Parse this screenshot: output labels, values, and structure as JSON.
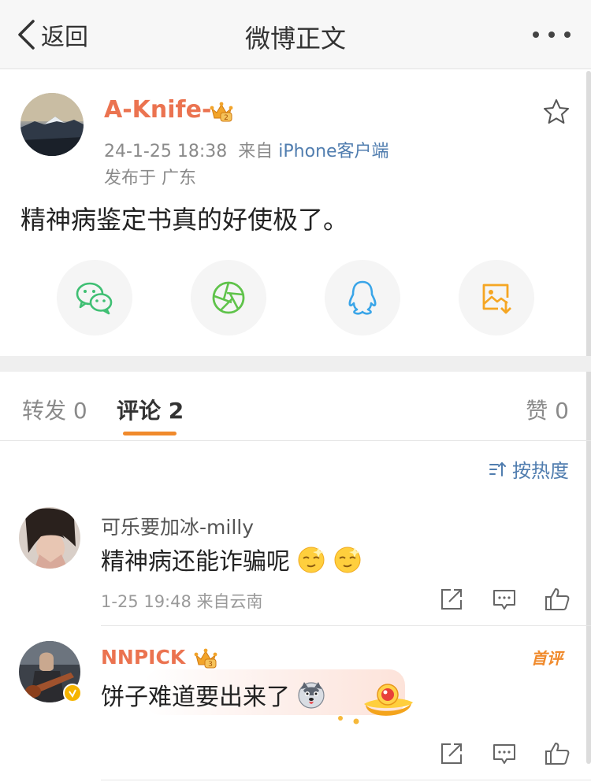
{
  "nav": {
    "back_label": "返回",
    "title": "微博正文"
  },
  "post": {
    "username": "A-Knife-",
    "timestamp": "24-1-25 18:38",
    "source_prefix": "来自",
    "source": "iPhone客户端",
    "location": "发布于 广东",
    "text": "精神病鉴定书真的好使极了。"
  },
  "share": [
    {
      "name": "wechat-icon"
    },
    {
      "name": "moments-icon"
    },
    {
      "name": "qq-icon"
    },
    {
      "name": "save-image-icon"
    }
  ],
  "tabs": {
    "repost": "转发 0",
    "comments": "评论 2",
    "likes": "赞 0"
  },
  "sort_label": "按热度",
  "comments": [
    {
      "username": "可乐要加冰-milly",
      "text": "精神病还能诈骗呢",
      "meta": "1-25 19:48  来自云南"
    },
    {
      "username": "NNPICK",
      "text": "饼子难道要出来了",
      "badge": "首评"
    }
  ],
  "colors": {
    "accent": "#eb7350",
    "link": "#507daf",
    "tab_underline": "#f08a2c"
  }
}
